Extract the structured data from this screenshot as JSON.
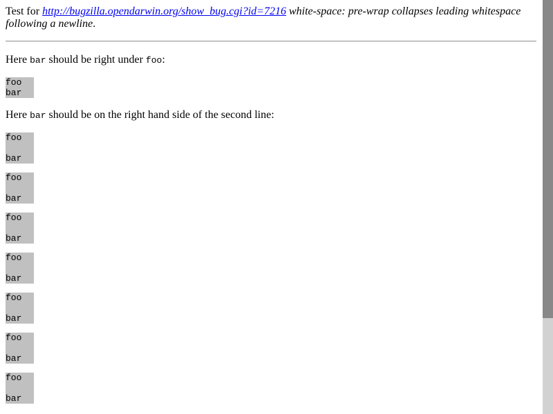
{
  "intro": {
    "prefix": "Test for ",
    "link_text": "http://bugzilla.opendarwin.org/show_bug.cgi?id=7216",
    "suffix": " white-space: pre-wrap collapses leading whitespace following a newline",
    "period": "."
  },
  "section1": {
    "text_before": "Here ",
    "code_a": "bar",
    "text_middle": " should be right under ",
    "code_b": "foo",
    "text_after": ":",
    "box": {
      "line1": "foo",
      "line2": "bar"
    }
  },
  "section2": {
    "text_before": "Here ",
    "code_a": "bar",
    "text_after": " should be on the right hand side of the second line:",
    "boxes": [
      {
        "line1": "foo",
        "line3": "bar"
      },
      {
        "line1": "foo",
        "line3": "bar"
      },
      {
        "line1": "foo",
        "line3": "bar"
      },
      {
        "line1": "foo",
        "line3": "bar"
      },
      {
        "line1": "foo",
        "line3": "bar"
      },
      {
        "line1": "foo",
        "line3": "bar"
      },
      {
        "line1": "foo",
        "line3": "bar"
      }
    ]
  }
}
